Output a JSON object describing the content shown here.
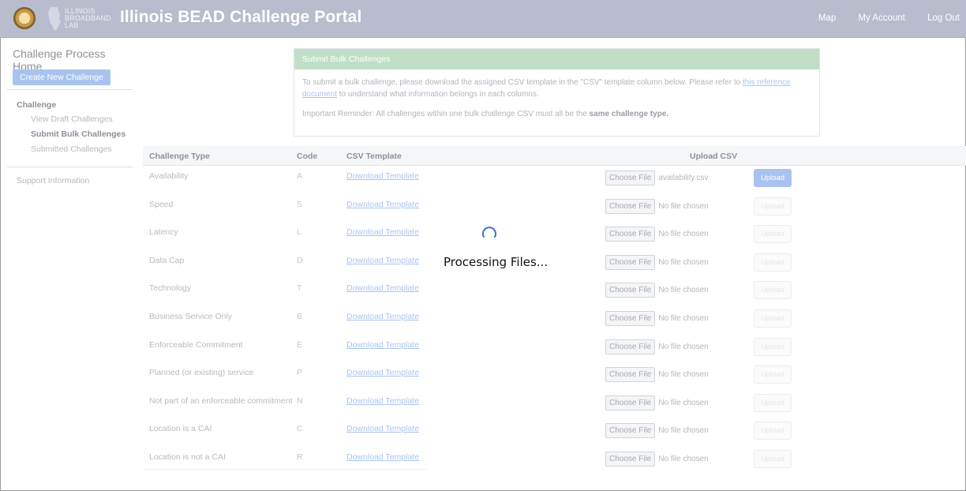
{
  "header": {
    "logo_lines": [
      "ILLINOIS",
      "BROADBAND",
      "LAB"
    ],
    "title": "Illinois BEAD Challenge Portal",
    "nav": [
      "Map",
      "My Account",
      "Log Out"
    ]
  },
  "sidebar": {
    "home": "Challenge Process Home",
    "create_button": "Create New Challenge",
    "group_label": "Challenge",
    "links": [
      "View Draft Challenges",
      "Submit Bulk Challenges",
      "Submitted Challenges"
    ],
    "support": "Support Information"
  },
  "bulk_panel": {
    "title": "Submit Bulk Challenges",
    "text_before_link": "To submit a bulk challenge, please download the assigned CSV template in the \"CSV\" template column below. Please refer to ",
    "link_text": "this reference document",
    "text_after_link": " to understand what information belongs in each columns.",
    "reminder_prefix": "Important Reminder: All challenges within one bulk challenge CSV must all be the ",
    "reminder_bold": "same challenge type."
  },
  "table": {
    "headers": {
      "type": "Challenge Type",
      "code": "Code",
      "template": "CSV Template",
      "upload": "Upload CSV"
    },
    "download_label": "Download Template",
    "choose_label": "Choose File",
    "upload_label": "Upload",
    "rows": [
      {
        "type": "Availability",
        "code": "A",
        "file": "availability.csv"
      },
      {
        "type": "Speed",
        "code": "S",
        "file": "No file chosen"
      },
      {
        "type": "Latency",
        "code": "L",
        "file": "No file chosen"
      },
      {
        "type": "Data Cap",
        "code": "D",
        "file": "No file chosen"
      },
      {
        "type": "Technology",
        "code": "T",
        "file": "No file chosen"
      },
      {
        "type": "Business Service Only",
        "code": "B",
        "file": "No file chosen"
      },
      {
        "type": "Enforceable Commitment",
        "code": "E",
        "file": "No file chosen"
      },
      {
        "type": "Planned (or existing) service",
        "code": "P",
        "file": "No file chosen"
      },
      {
        "type": "Not part of an enforceable commitment",
        "code": "N",
        "file": "No file chosen"
      },
      {
        "type": "Location is a CAI",
        "code": "C",
        "file": "No file chosen"
      },
      {
        "type": "Location is not a CAI",
        "code": "R",
        "file": "No file chosen"
      }
    ]
  },
  "overlay": {
    "message": "Processing Files...",
    "spinner_icon": "loading-spinner-icon"
  },
  "colors": {
    "header_bg": "#b9bccc",
    "panel_head": "#c1dfc8",
    "primary_button": "#a9c3ee",
    "link": "#a9c4f0"
  }
}
